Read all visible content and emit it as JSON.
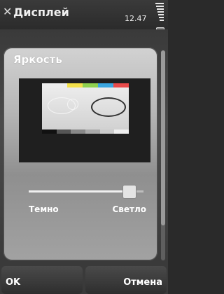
{
  "header": {
    "title": "Дисплей",
    "time": "12.47",
    "close_icon": "close-icon"
  },
  "dialog": {
    "title": "Яркость",
    "brightness_level": 0.92,
    "label_min": "Темно",
    "label_max": "Светло",
    "preview_colors": [
      "#f3e04a",
      "#8fd14f",
      "#3aa6e0",
      "#e84a4a"
    ],
    "preview_grays": [
      "#111111",
      "#555555",
      "#888888",
      "#aaaaaa",
      "#cccccc",
      "#eeeeee"
    ]
  },
  "softkeys": {
    "left": "OK",
    "right": "Отмена"
  }
}
